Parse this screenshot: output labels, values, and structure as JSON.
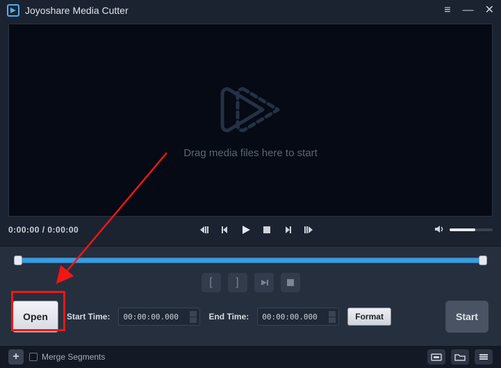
{
  "app": {
    "title": "Joyoshare Media Cutter"
  },
  "video": {
    "drop_hint": "Drag media files here to start",
    "time_readout": "0:00:00 / 0:00:00"
  },
  "editor": {
    "open_label": "Open",
    "start_time_label": "Start Time:",
    "start_time_value": "00:00:00.000",
    "end_time_label": "End Time:",
    "end_time_value": "00:00:00.000",
    "format_label": "Format",
    "start_label": "Start"
  },
  "bottom": {
    "merge_label": "Merge Segments"
  }
}
